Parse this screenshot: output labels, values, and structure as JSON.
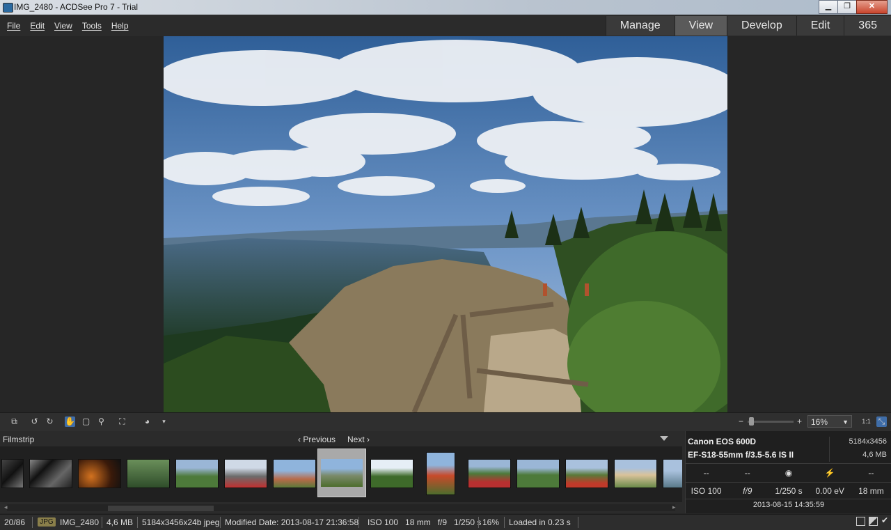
{
  "window": {
    "title": "IMG_2480 - ACDSee Pro 7 - Trial",
    "minimize": "▁",
    "restore": "❐",
    "close": "✕"
  },
  "menu": {
    "items": [
      "File",
      "Edit",
      "View",
      "Tools",
      "Help"
    ]
  },
  "modes": [
    "Manage",
    "View",
    "Develop",
    "Edit",
    "365"
  ],
  "active_mode": "View",
  "toolbar": {
    "zoom_value": "16%",
    "icons": [
      "import-icon",
      "rotate-left-icon",
      "rotate-right-icon",
      "hand-icon",
      "select-icon",
      "zoom-tool-icon",
      "fullscreen-icon",
      "palette-icon"
    ]
  },
  "filmstrip": {
    "label": "Filmstrip",
    "previous": "Previous",
    "next": "Next",
    "thumbnails": 14,
    "selected_index": 7
  },
  "info": {
    "camera": "Canon EOS 600D",
    "lens": "EF-S18-55mm f/3.5-5.6 IS II",
    "dimensions": "5184x3456",
    "file_size": "4,6 MB",
    "metering": "--",
    "exposure_program": "--",
    "iso": "ISO 100",
    "aperture": "f/9",
    "shutter": "1/250 s",
    "exposure_bias": "0.00 eV",
    "focal_length": "18 mm",
    "date": "2013-08-15 14:35:59"
  },
  "status": {
    "index": "20/86",
    "format": "JPG",
    "filename": "IMG_2480",
    "size": "4,6 MB",
    "dims": "5184x3456x24b jpeg",
    "modified": "Modified Date: 2013-08-17 21:36:58",
    "exif": "ISO 100   18 mm   f/9   1/250 s",
    "zoom": "16%",
    "loaded": "Loaded in 0.23 s"
  }
}
